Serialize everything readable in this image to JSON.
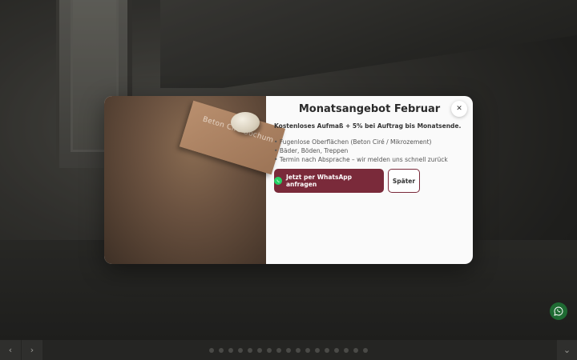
{
  "modal": {
    "title": "Monatsangebot Februar",
    "subtitle": "Kostenloses Aufmaß + 5% bei Auftrag bis Monatsende.",
    "bullets": [
      "Fugenlose Oberflächen (Beton Ciré / Mikrozement)",
      "Bäder, Böden, Treppen",
      "Termin nach Absprache – wir melden uns schnell zurück"
    ],
    "primary_button": "Jetzt per WhatsApp anfragen",
    "secondary_button": "Später",
    "close_icon": "close-icon",
    "image_card_text": "Beton Ciré Bochum",
    "accent_color": "#7a2a3a"
  },
  "slider": {
    "prev_icon": "chevron-left-icon",
    "next_icon": "chevron-right-icon",
    "dot_count": 17,
    "end_icon": "chevron-down-icon"
  },
  "whatsapp_float": {
    "icon": "whatsapp-icon",
    "color": "#1f6b33"
  }
}
